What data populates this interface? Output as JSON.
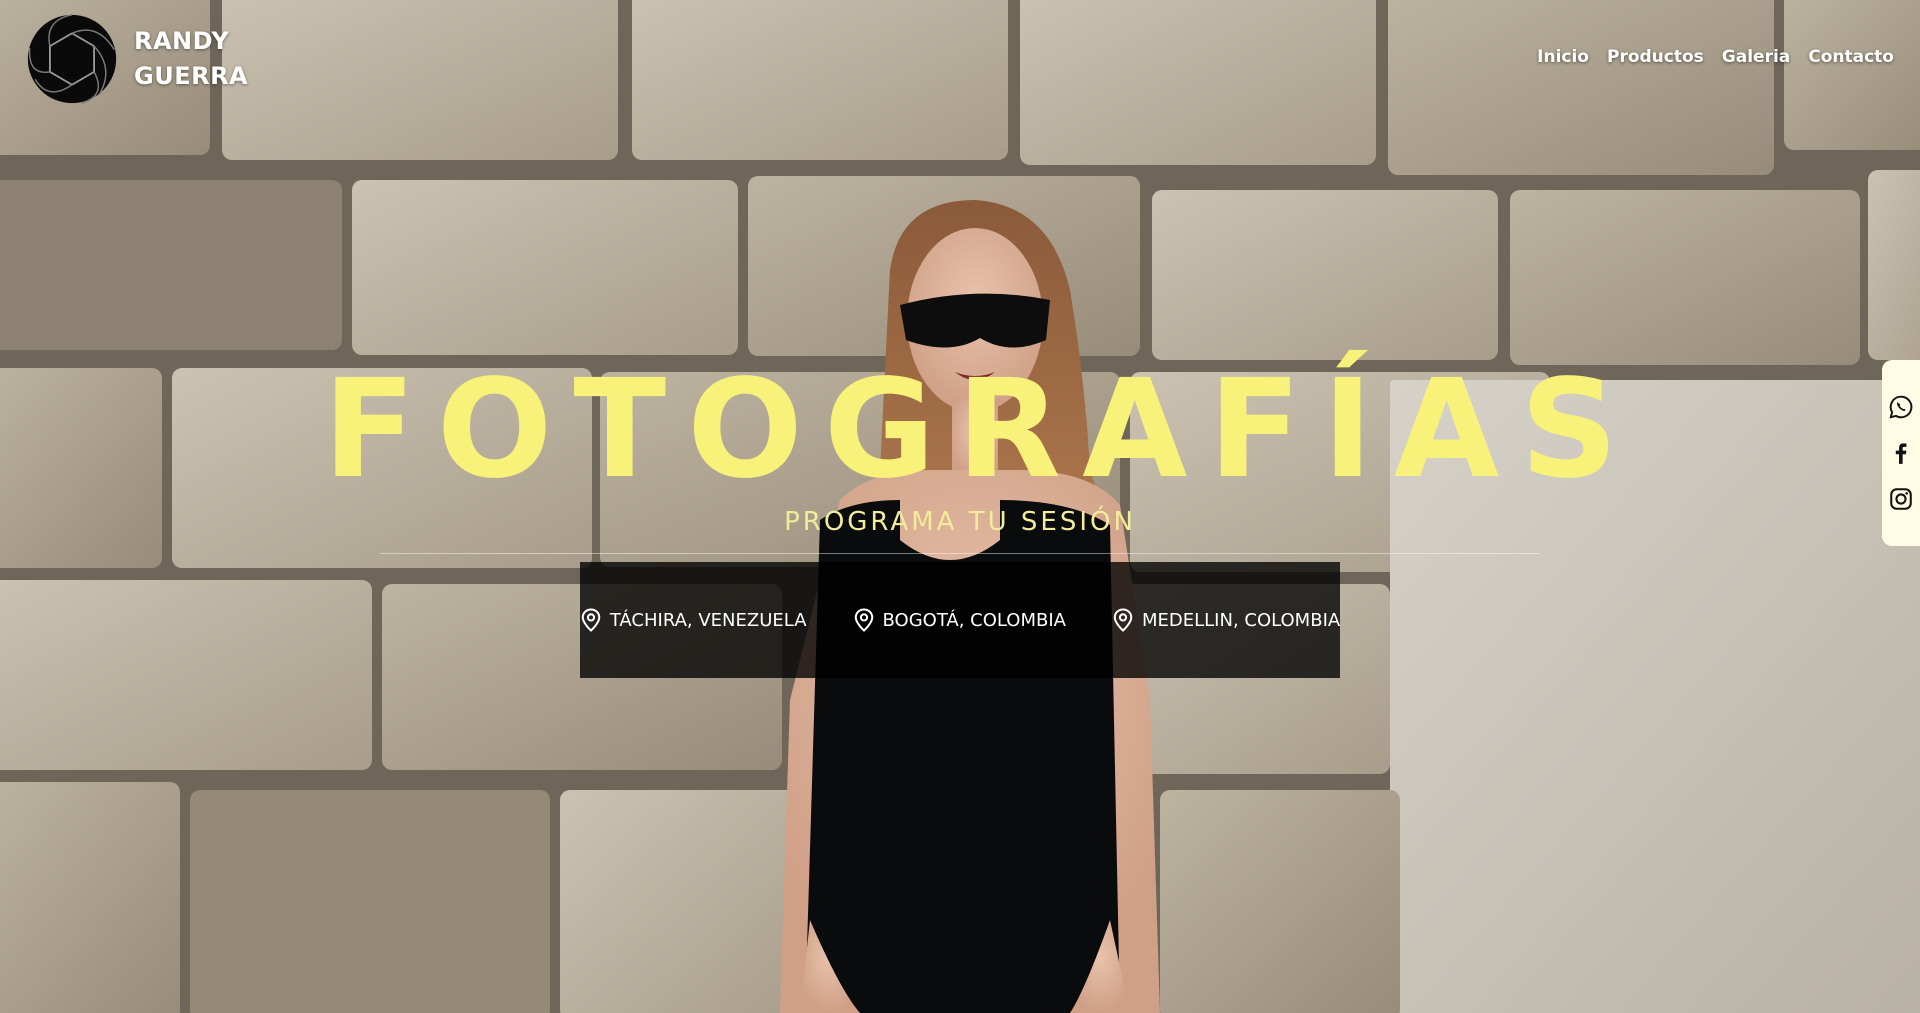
{
  "brand": {
    "name_line1": "RANDY",
    "name_line2": "GUERRA",
    "logo_icon": "camera-aperture-icon"
  },
  "nav": {
    "items": [
      "Inicio",
      "Productos",
      "Galeria",
      "Contacto"
    ]
  },
  "hero": {
    "title": "FOTOGRAFÍAS",
    "subtitle": "PROGRAMA TU SESIÓN",
    "locations": [
      {
        "label": "TÁCHIRA, VENEZUELA",
        "icon": "map-pin-icon"
      },
      {
        "label": "BOGOTÁ, COLOMBIA",
        "icon": "map-pin-icon"
      },
      {
        "label": "MEDELLIN, COLOMBIA",
        "icon": "map-pin-icon"
      }
    ]
  },
  "social": {
    "icons": [
      "whatsapp-icon",
      "facebook-icon",
      "instagram-icon"
    ]
  },
  "colors": {
    "title_yellow": "#f8f17a",
    "subtitle_yellow": "#f3ec9a",
    "locations_bg": "#000000",
    "social_bg": "#fffbe4",
    "text_white": "#ffffff"
  }
}
